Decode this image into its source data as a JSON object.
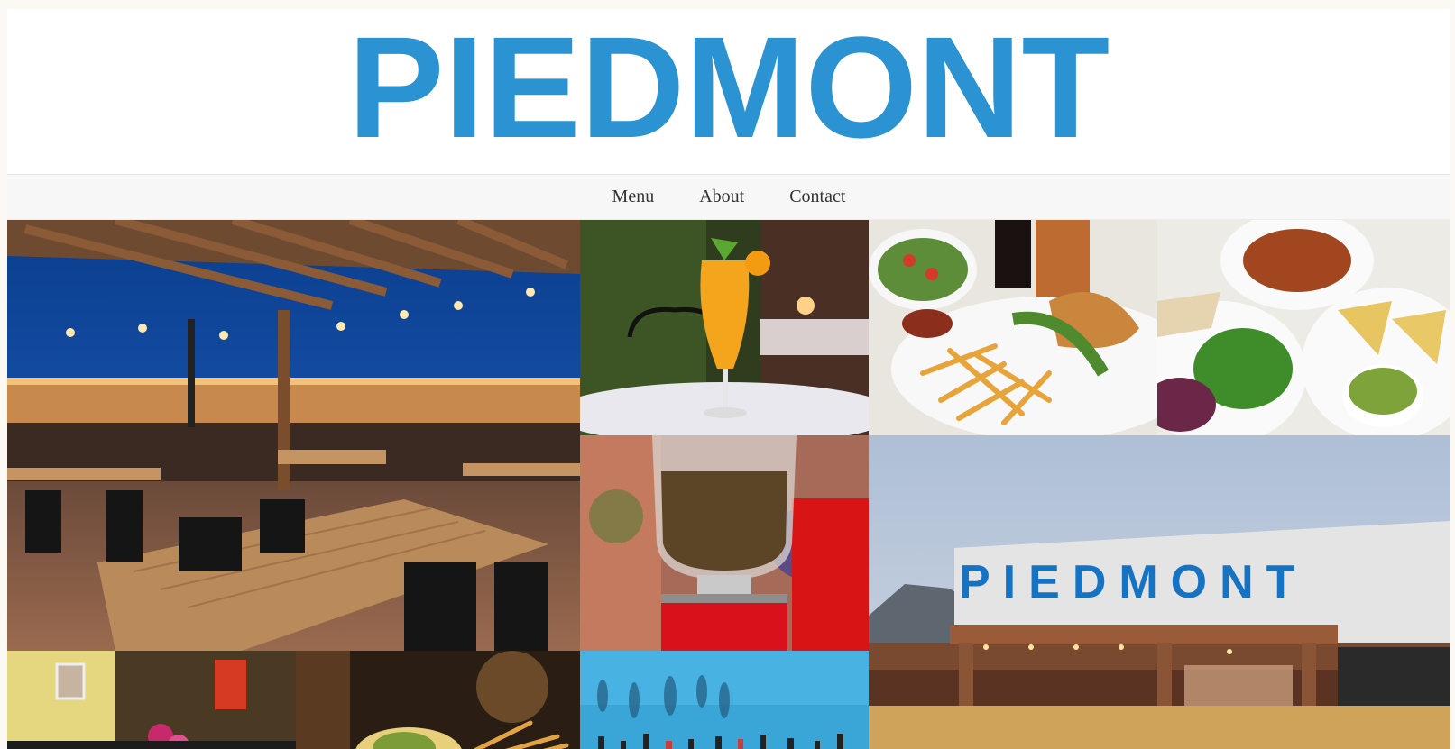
{
  "site": {
    "title": "PIEDMONT"
  },
  "nav": {
    "items": [
      {
        "label": "Menu"
      },
      {
        "label": "About"
      },
      {
        "label": "Contact"
      }
    ]
  },
  "gallery": {
    "storefront_sign": "PIEDMONT",
    "photos": [
      "patio-night",
      "orange-cocktail",
      "burger-fries-salad",
      "guacamole-chips-plates",
      "coffee-grinder",
      "storefront-exterior",
      "interior-flowers",
      "fries-bowl",
      "bar-mural"
    ]
  },
  "colors": {
    "brand": "#2b93d1",
    "nav_bg": "#f7f7f7"
  }
}
